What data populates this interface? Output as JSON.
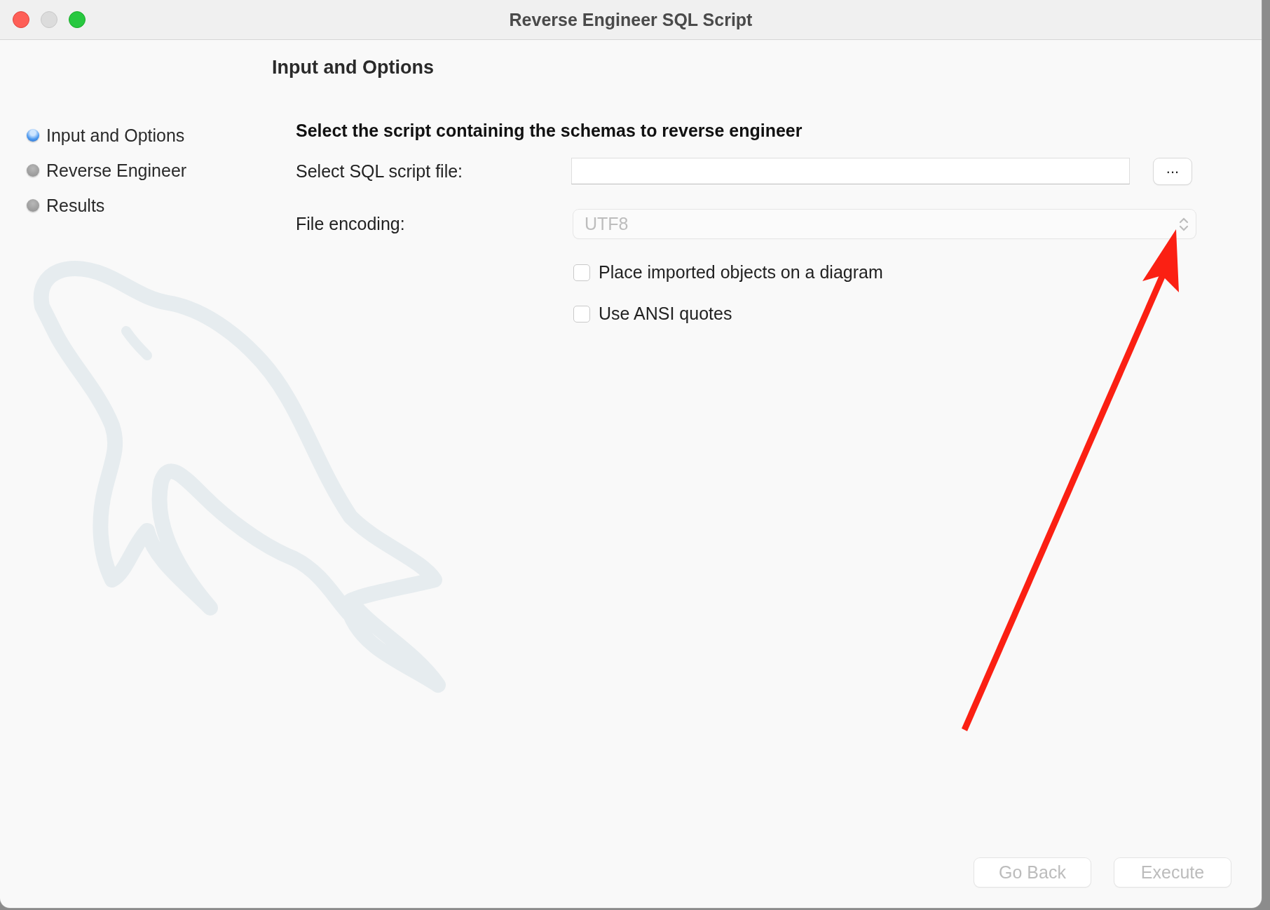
{
  "window": {
    "title": "Reverse Engineer SQL Script"
  },
  "steps": [
    {
      "label": "Input and Options",
      "selected": true
    },
    {
      "label": "Reverse Engineer",
      "selected": false
    },
    {
      "label": "Results",
      "selected": false
    }
  ],
  "page_title": "Input and Options",
  "section_title": "Select the script containing the schemas to reverse engineer",
  "script_file": {
    "label": "Select SQL script file:",
    "browse_button": "..."
  },
  "encoding": {
    "label": "File encoding:",
    "value": "UTF8",
    "disabled": true
  },
  "options": [
    {
      "label": "Place imported objects on a diagram",
      "checked": false
    },
    {
      "label": "Use ANSI quotes",
      "checked": false
    }
  ],
  "buttons": [
    {
      "label": "Go Back",
      "disabled": true
    },
    {
      "label": "Execute",
      "disabled": true
    }
  ]
}
